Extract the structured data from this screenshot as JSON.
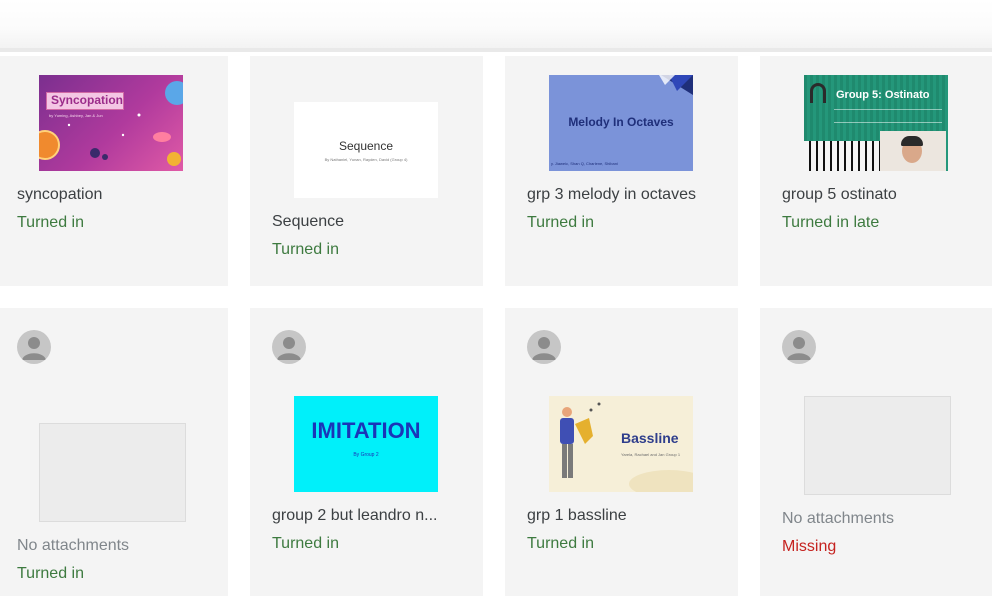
{
  "cards": [
    {
      "title": "syncopation",
      "status": "Turned in",
      "thumb": {
        "heading": "Syncopation",
        "sub": "by Yuming, Ashbey, Jan & Jun"
      }
    },
    {
      "title": "Sequence",
      "status": "Turned in",
      "thumb": {
        "heading": "Sequence",
        "sub": "By Nathaniel, Yunan, Rayden, David (Group 4)"
      }
    },
    {
      "title": "grp 3 melody in octaves",
      "status": "Turned in",
      "thumb": {
        "heading": "Melody In Octaves",
        "sub": "y. Jiaweic, Shan Q, Charlene, Shibani"
      }
    },
    {
      "title": "group 5 ostinato",
      "status": "Turned in late",
      "thumb": {
        "heading": "Group 5: Ostinato"
      }
    },
    {
      "subtitle": "No attachments",
      "status": "Turned in"
    },
    {
      "title": "group 2 but leandro n...",
      "status": "Turned in",
      "thumb": {
        "heading": "IMITATION",
        "sub": "By Group 2"
      }
    },
    {
      "title": "grp 1 bassline",
      "status": "Turned in",
      "thumb": {
        "heading": "Bassline",
        "sub": "Yarela, Rachael and Jan Group 1"
      }
    },
    {
      "subtitle": "No attachments",
      "status": "Missing"
    }
  ],
  "colors": {
    "turned_in": "#3d7a3f",
    "missing": "#c5221f",
    "card_bg": "#f4f4f4"
  },
  "icons": {
    "avatar": "default-avatar-icon"
  }
}
